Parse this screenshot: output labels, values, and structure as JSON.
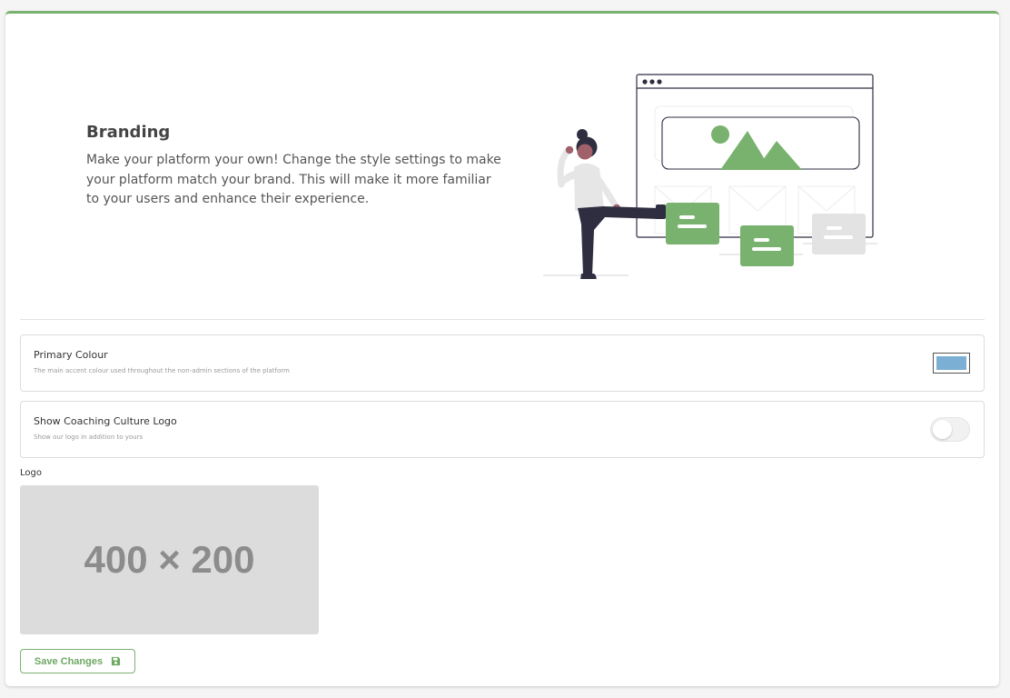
{
  "hero": {
    "title": "Branding",
    "description": "Make your platform your own! Change the style settings to make your platform match your brand. This will make it more familiar to your users and enhance their experience."
  },
  "settings": {
    "primary_colour": {
      "title": "Primary Colour",
      "subtitle": "The main accent colour used throughout the non-admin sections of the platform",
      "value": "#7bafd4"
    },
    "show_logo": {
      "title": "Show Coaching Culture Logo",
      "subtitle": "Show our logo in addition to yours",
      "enabled": false
    }
  },
  "logo": {
    "label": "Logo",
    "placeholder": "400 × 200"
  },
  "actions": {
    "save_label": "Save Changes",
    "save_icon": "floppy-disk-icon"
  },
  "colors": {
    "accent": "#79b26e",
    "inactive": "#e0e0e0",
    "figure_dark": "#2f2e41"
  }
}
